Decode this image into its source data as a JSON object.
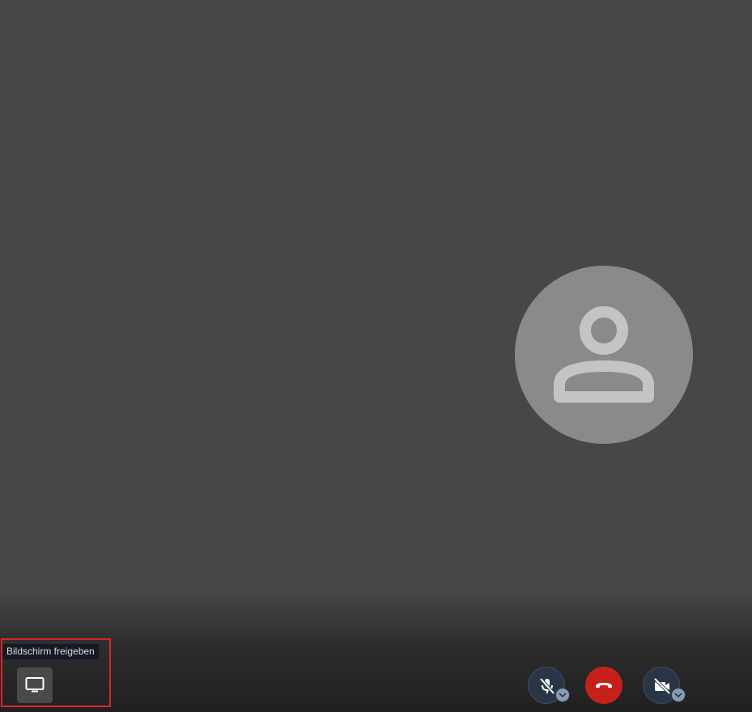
{
  "tooltip": {
    "text": "Bildschirm freigeben"
  },
  "participant": {
    "avatar_icon": "person-icon"
  },
  "toolbar": {
    "share_icon": "monitor-icon",
    "mic_icon": "microphone-off-icon",
    "hangup_icon": "phone-hangup-icon",
    "camera_icon": "camera-off-icon",
    "chevron_icon": "chevron-down-icon"
  },
  "colors": {
    "background": "#474747",
    "avatar_bg": "#8a8a8a",
    "hangup": "#c6201b",
    "control_bg": "#2a3648",
    "highlight": "#d5262b"
  }
}
